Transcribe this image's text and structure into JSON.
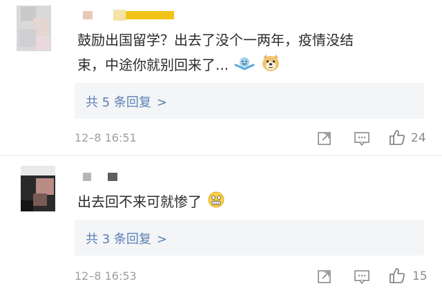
{
  "comments": [
    {
      "text_line1": "鼓励出国留学？出去了没个一两年，疫情没结",
      "text_line2": "束，中途你就别回来了...",
      "emojis": [
        "shrug-emoji",
        "doge-emoji"
      ],
      "replies_label": "共 5 条回复",
      "replies_arrow": ">",
      "timestamp": "12–8 16:51",
      "like_count": "24"
    },
    {
      "text_line1": "出去回不来可就惨了",
      "emojis": [
        "grimace-emoji"
      ],
      "replies_label": "共 3 条回复",
      "replies_arrow": ">",
      "timestamp": "12–8 16:53",
      "like_count": "15"
    }
  ],
  "icons": {
    "share": "share-icon",
    "comment": "comment-icon",
    "like": "thumbs-up-icon"
  },
  "colors": {
    "reply_link": "#5a7fb4",
    "reply_bg": "#f4f5f7",
    "timestamp": "#9e9e9e",
    "avatar_name_accent": "#f2c417"
  }
}
